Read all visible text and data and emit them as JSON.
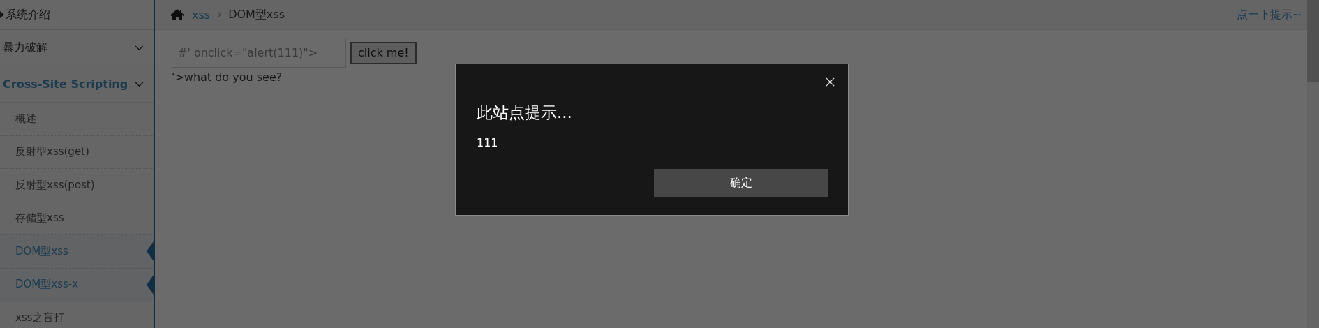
{
  "sidebar": {
    "items": [
      {
        "label": "系统介绍",
        "kind": "link",
        "selected": false
      },
      {
        "label": "暴力破解",
        "kind": "group",
        "selected": false
      },
      {
        "label": "Cross-Site Scripting",
        "kind": "group",
        "selected": true,
        "children": [
          {
            "label": "概述",
            "selected": false
          },
          {
            "label": "反射型xss(get)",
            "selected": false
          },
          {
            "label": "反射型xss(post)",
            "selected": false
          },
          {
            "label": "存储型xss",
            "selected": false
          },
          {
            "label": "DOM型xss",
            "selected": true
          },
          {
            "label": "DOM型xss-x",
            "selected": true
          },
          {
            "label": "xss之盲打",
            "selected": false
          }
        ]
      }
    ]
  },
  "breadcrumb": [
    {
      "label": "xss",
      "kind": "link"
    },
    {
      "label": "DOM型xss",
      "kind": "current"
    }
  ],
  "hint_link": "点一下提示~",
  "form": {
    "input_value": "#' onclick=\"alert(111)\">",
    "button": "click me!",
    "output": "'>what do you see?"
  },
  "dialog": {
    "title": "此站点提示...",
    "message": "111",
    "button": "确定"
  }
}
